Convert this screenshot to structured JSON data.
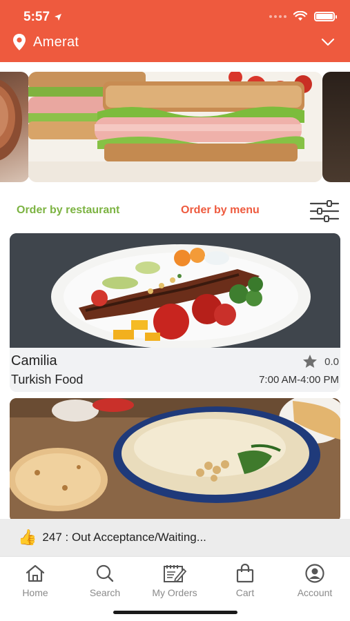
{
  "status_bar": {
    "time": "5:57"
  },
  "header": {
    "location": "Amerat"
  },
  "order_tabs": {
    "by_restaurant": "Order by restaurant",
    "by_menu": "Order by menu"
  },
  "restaurants": [
    {
      "name": "Camilia",
      "cuisine": "Turkish Food",
      "rating": "0.0",
      "hours": "7:00 AM-4:00 PM"
    }
  ],
  "notice": {
    "text": "247 : Out Acceptance/Waiting..."
  },
  "bottom_nav": {
    "home": "Home",
    "search": "Search",
    "orders": "My Orders",
    "cart": "Cart",
    "account": "Account"
  },
  "colors": {
    "brand": "#ee5a3e",
    "green": "#7cb342"
  }
}
